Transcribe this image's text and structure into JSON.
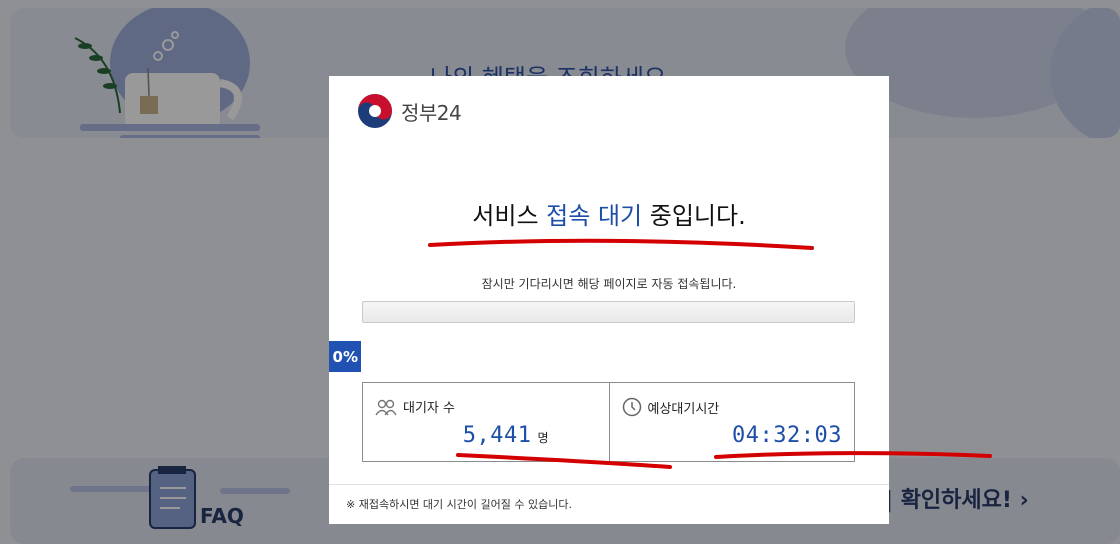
{
  "background": {
    "title": "나의 혜택을 조회하세요",
    "faq_label": "FAQ",
    "bottom_link": "| 확인하세요! ›"
  },
  "modal": {
    "logo_text": "정부24",
    "headline_pre": "서비스 ",
    "headline_highlight": "접속 대기",
    "headline_post": " 중입니다.",
    "subtext": "잠시만 기다리시면 해당 페이지로 자동 접속됩니다.",
    "progress_percent": 0,
    "progress_label": "0%",
    "stats": {
      "waiting_label": "대기자 수",
      "waiting_value": "5,441",
      "waiting_unit": "명",
      "eta_label": "예상대기시간",
      "eta_value": "04:32:03"
    },
    "footnote": "※ 재접속하시면 대기 시간이 길어질 수 있습니다."
  },
  "colors": {
    "accent": "#1d4fa8",
    "badge": "#2151b3",
    "annotation": "#d40000"
  },
  "icons": [
    "people-icon",
    "clock-icon",
    "gov24-logo"
  ]
}
